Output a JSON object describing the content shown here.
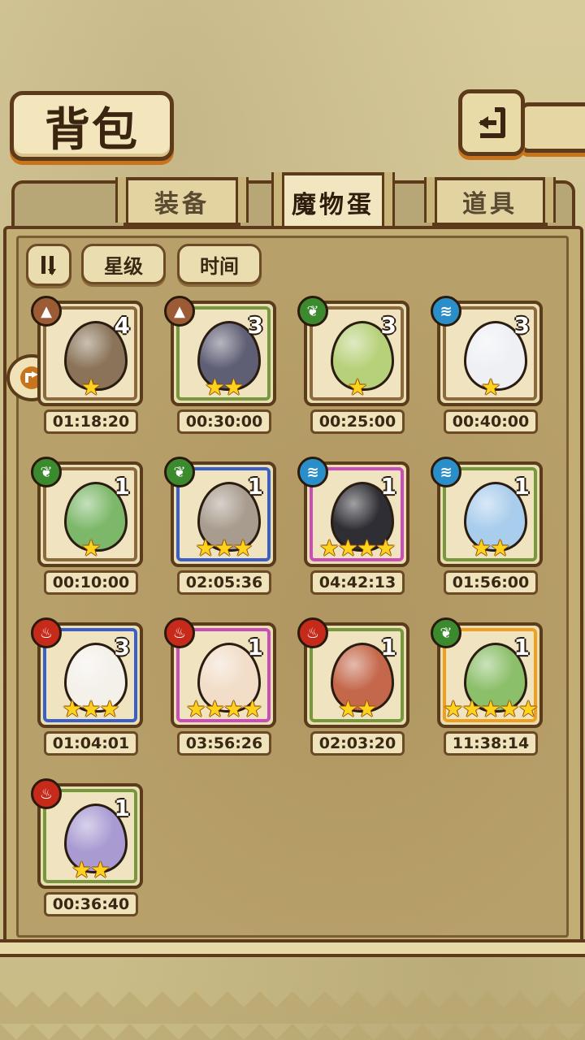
{
  "header": {
    "title": "背包"
  },
  "tabs": [
    {
      "label": "装备"
    },
    {
      "label": "魔物蛋"
    },
    {
      "label": "道具"
    }
  ],
  "sort": {
    "star_label": "星级",
    "time_label": "时间"
  },
  "eggs": [
    {
      "element": "earth",
      "qty": "4",
      "stars": "★",
      "timer": "01:18:20",
      "frame": "brown",
      "color": "#8a7358"
    },
    {
      "element": "earth",
      "qty": "3",
      "stars": "★★",
      "timer": "00:30:00",
      "frame": "green",
      "color": "#5e5e74"
    },
    {
      "element": "grass",
      "qty": "3",
      "stars": "★",
      "timer": "00:25:00",
      "frame": "brown",
      "color": "#b7d17a"
    },
    {
      "element": "water",
      "qty": "3",
      "stars": "★",
      "timer": "00:40:00",
      "frame": "brown",
      "color": "#eef0f4"
    },
    {
      "element": "grass",
      "qty": "1",
      "stars": "★",
      "timer": "00:10:00",
      "frame": "brown",
      "color": "#7db86a"
    },
    {
      "element": "grass",
      "qty": "1",
      "stars": "★★★",
      "timer": "02:05:36",
      "frame": "blue",
      "color": "#a89c8e"
    },
    {
      "element": "water",
      "qty": "1",
      "stars": "★★★★",
      "timer": "04:42:13",
      "frame": "pink",
      "color": "#2e2e34"
    },
    {
      "element": "water",
      "qty": "1",
      "stars": "★★",
      "timer": "01:56:00",
      "frame": "green",
      "color": "#a9cdec"
    },
    {
      "element": "fire",
      "qty": "3",
      "stars": "★★★",
      "timer": "01:04:01",
      "frame": "blue",
      "color": "#f4f0ea"
    },
    {
      "element": "fire",
      "qty": "1",
      "stars": "★★★★",
      "timer": "03:56:26",
      "frame": "pink",
      "color": "#f1ddc8"
    },
    {
      "element": "fire",
      "qty": "1",
      "stars": "★★",
      "timer": "02:03:20",
      "frame": "green",
      "color": "#c4674a"
    },
    {
      "element": "grass",
      "qty": "1",
      "stars": "★★★★★",
      "timer": "11:38:14",
      "frame": "gold",
      "color": "#8cbf6a"
    },
    {
      "element": "fire",
      "qty": "1",
      "stars": "★★",
      "timer": "00:36:40",
      "frame": "green",
      "color": "#a99bd2"
    }
  ]
}
